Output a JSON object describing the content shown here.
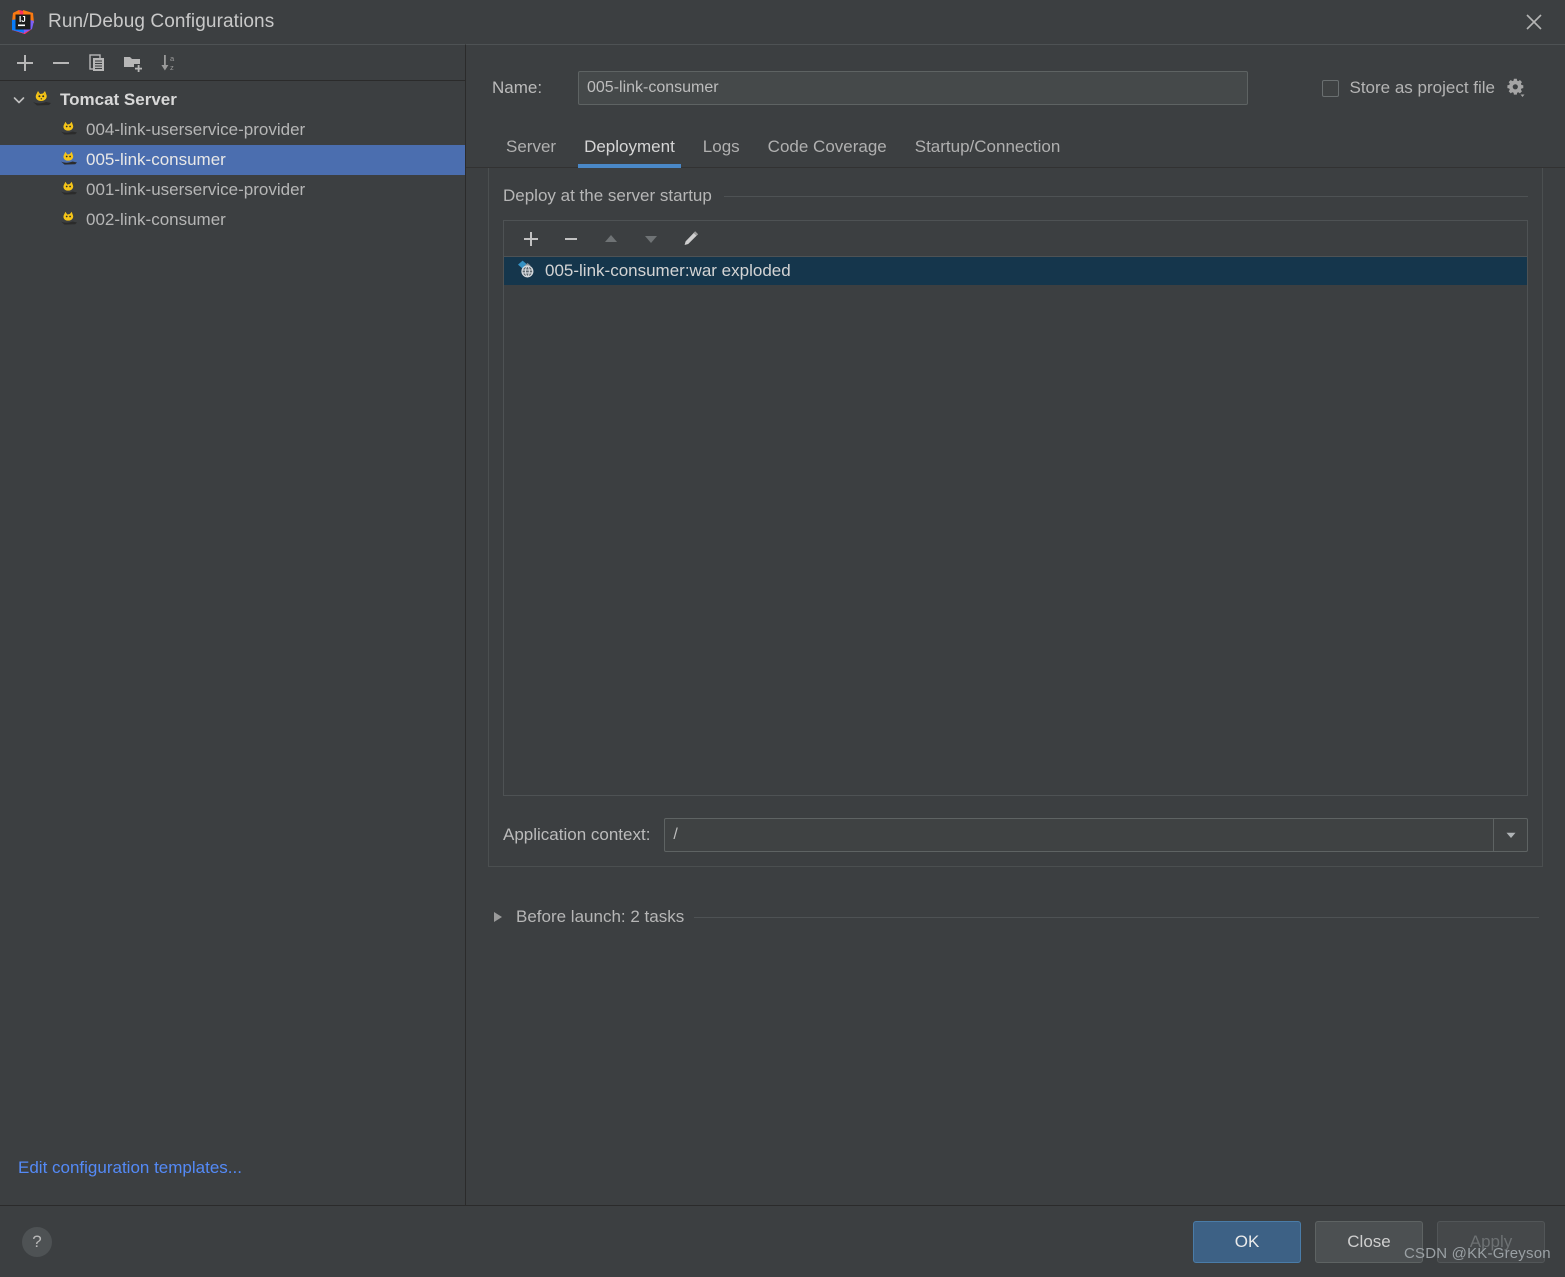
{
  "window": {
    "title": "Run/Debug Configurations",
    "app_icon": "intellij-idea-logo",
    "close_icon": "close-icon"
  },
  "sidebar": {
    "toolbar": [
      {
        "name": "add-configuration-button",
        "icon": "plus-icon",
        "label": "+"
      },
      {
        "name": "remove-configuration-button",
        "icon": "minus-icon",
        "label": "−"
      },
      {
        "name": "copy-configuration-button",
        "icon": "copy-icon",
        "label": "Copy"
      },
      {
        "name": "save-configuration-button",
        "icon": "folder-add-icon",
        "label": "Save configuration"
      },
      {
        "name": "sort-configurations-button",
        "icon": "sort-alphabetical-icon",
        "label": "Sort"
      }
    ],
    "tree": {
      "root": {
        "label": "Tomcat Server",
        "icon": "tomcat-icon",
        "expanded": true
      },
      "items": [
        {
          "label": "004-link-userservice-provider",
          "icon": "tomcat-icon",
          "selected": false
        },
        {
          "label": "005-link-consumer",
          "icon": "tomcat-icon",
          "selected": true
        },
        {
          "label": "001-link-userservice-provider",
          "icon": "tomcat-icon",
          "selected": false
        },
        {
          "label": "002-link-consumer",
          "icon": "tomcat-icon",
          "selected": false
        }
      ]
    },
    "footer_link": "Edit configuration templates..."
  },
  "main": {
    "name_label": "Name:",
    "name_value": "005-link-consumer",
    "name_placeholder": "Name",
    "store_as_project_file": {
      "label": "Store as project file",
      "checked": false,
      "gear_icon": "gear-icon"
    },
    "tabs": [
      {
        "label": "Server",
        "active": false
      },
      {
        "label": "Deployment",
        "active": true
      },
      {
        "label": "Logs",
        "active": false
      },
      {
        "label": "Code Coverage",
        "active": false
      },
      {
        "label": "Startup/Connection",
        "active": false
      }
    ],
    "deployment": {
      "group_title": "Deploy at the server startup",
      "list_toolbar": [
        {
          "name": "add-artifact-button",
          "icon": "plus-icon",
          "enabled": true
        },
        {
          "name": "remove-artifact-button",
          "icon": "minus-icon",
          "enabled": true
        },
        {
          "name": "move-up-button",
          "icon": "arrow-up-icon",
          "enabled": false
        },
        {
          "name": "move-down-button",
          "icon": "arrow-down-icon",
          "enabled": false
        },
        {
          "name": "edit-artifact-button",
          "icon": "pencil-icon",
          "enabled": true
        }
      ],
      "items": [
        {
          "label": "005-link-consumer:war exploded",
          "icon": "artifact-icon",
          "selected": true
        }
      ],
      "application_context": {
        "label": "Application context:",
        "value": "/",
        "placeholder": "/",
        "dropdown_icon": "chevron-down-icon"
      }
    },
    "before_launch": {
      "label": "Before launch: 2 tasks",
      "expanded": false,
      "triangle_icon": "triangle-right-icon"
    }
  },
  "footer": {
    "help_label": "?",
    "buttons": [
      {
        "label": "OK",
        "style": "primary",
        "enabled": true
      },
      {
        "label": "Close",
        "style": "default",
        "enabled": true
      },
      {
        "label": "Apply",
        "style": "disabled",
        "enabled": false
      }
    ]
  },
  "watermark": "CSDN @KK-Greyson",
  "colors": {
    "accent": "#4a88c7",
    "selection": "#4b6eaf",
    "list_selection": "#15364c",
    "link": "#548af7",
    "primary_button": "#3d6185",
    "background": "#3c3f41"
  }
}
